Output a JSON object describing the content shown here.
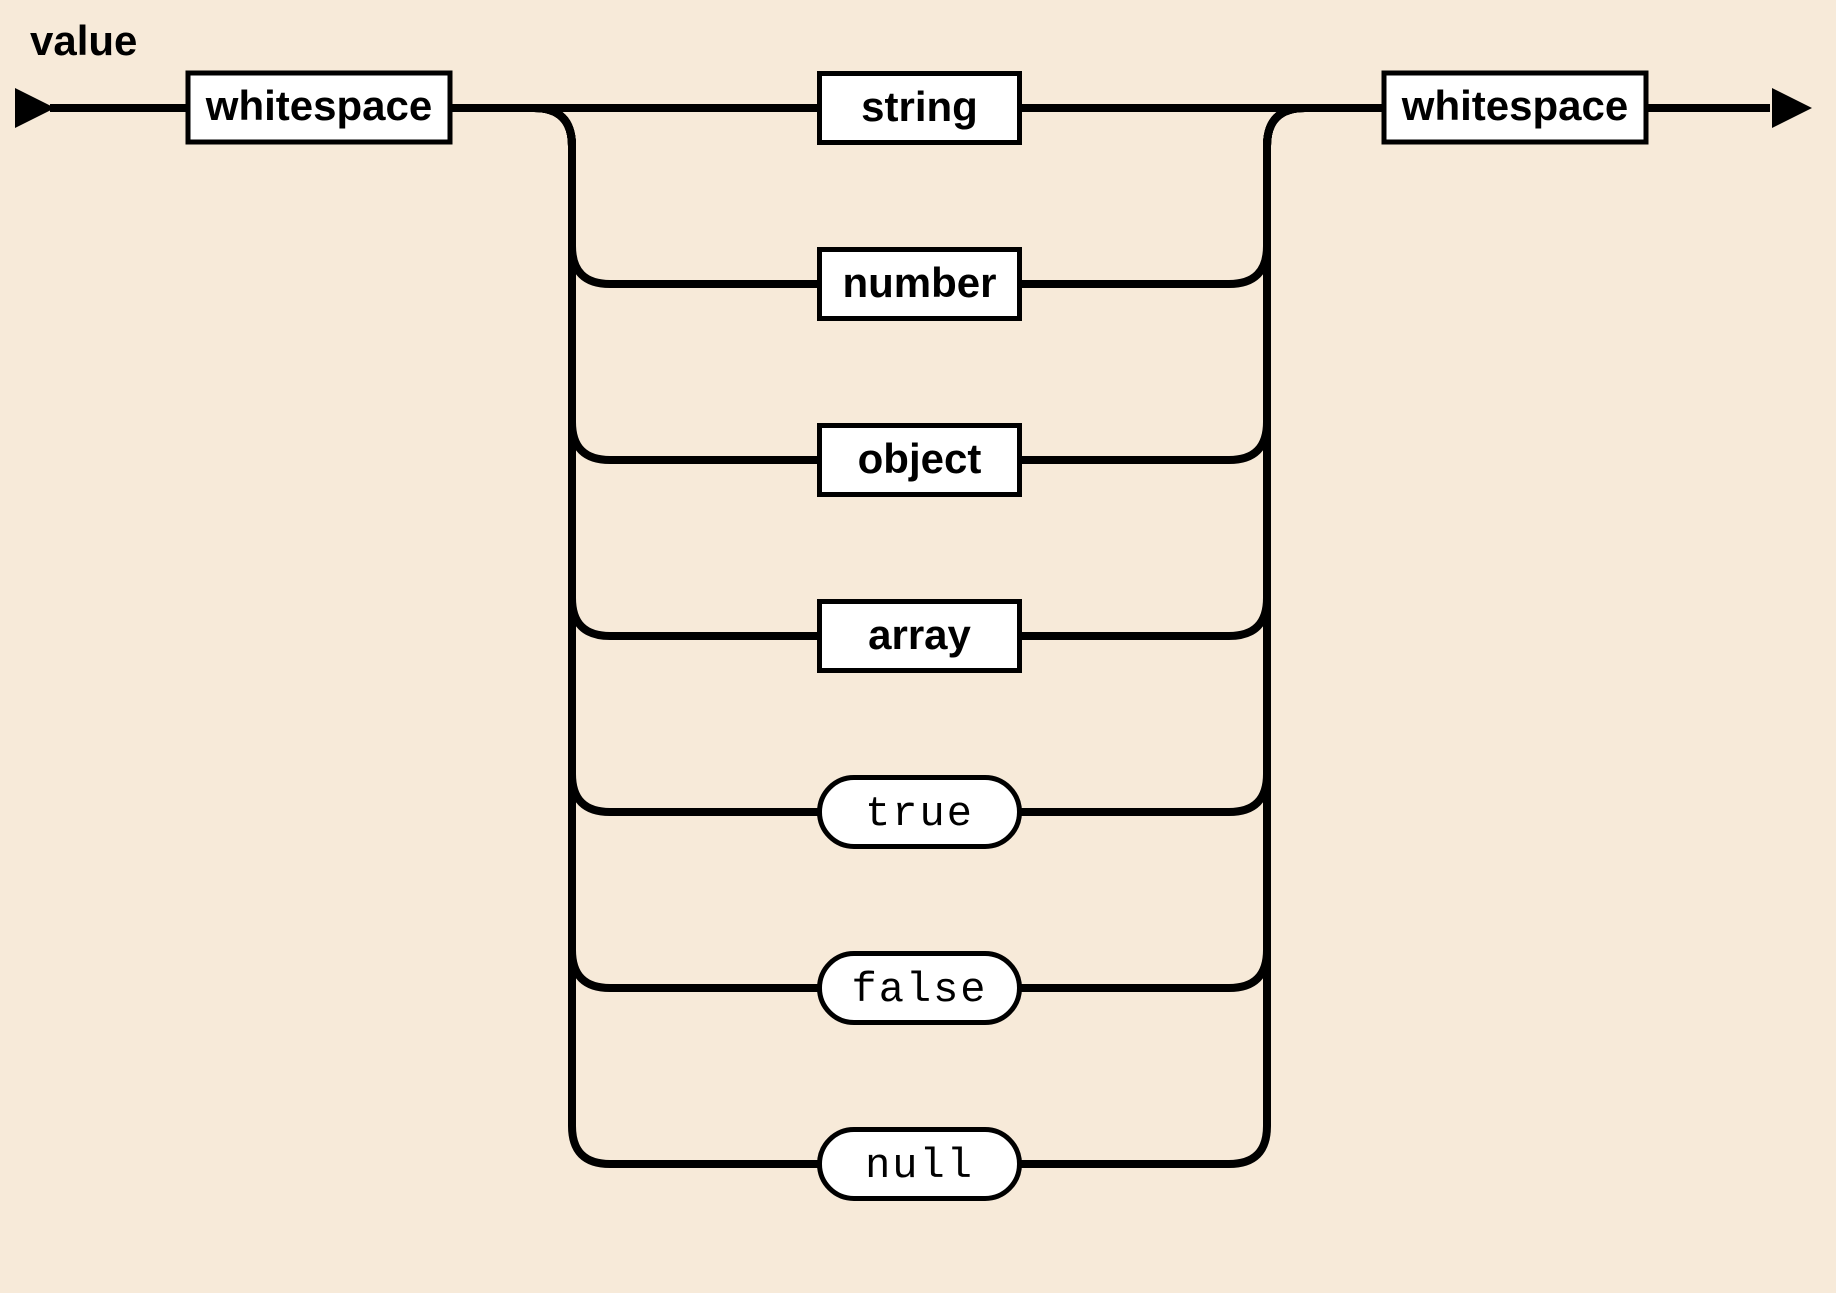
{
  "title": "value",
  "lead": "whitespace",
  "trail": "whitespace",
  "alternatives": [
    {
      "label": "string",
      "shape": "rect"
    },
    {
      "label": "number",
      "shape": "rect"
    },
    {
      "label": "object",
      "shape": "rect"
    },
    {
      "label": "array",
      "shape": "rect"
    },
    {
      "label": "true",
      "shape": "round"
    },
    {
      "label": "false",
      "shape": "round"
    },
    {
      "label": "null",
      "shape": "round"
    }
  ]
}
